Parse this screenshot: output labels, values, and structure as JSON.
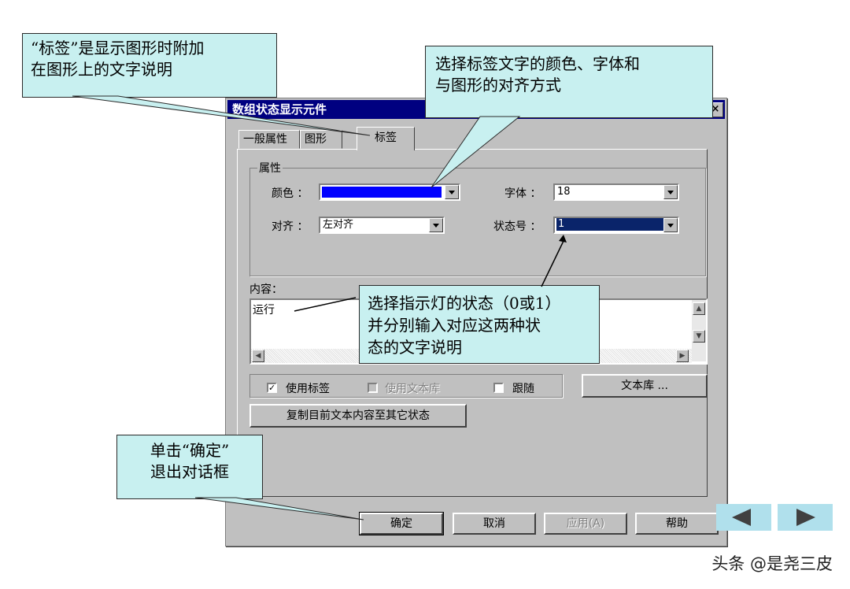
{
  "dialog": {
    "title": "数组状态显示元件",
    "close": "×",
    "tabs": [
      "一般属性",
      "图形",
      "标签"
    ],
    "group_label": "属性",
    "color_label": "颜色 ：",
    "color_value": "#0000ff",
    "align_label": "对齐 ：",
    "align_value": "左对齐",
    "font_label": "字体 ：",
    "font_value": "18",
    "state_label": "状态号 ：",
    "state_value": "1",
    "content_label": "内容：",
    "content_value": "运行",
    "use_label": "使用标签",
    "use_label_checked": true,
    "use_text_lib": "使用文本库",
    "follow": "跟随",
    "text_lib_button": "文本库 ...",
    "copy_button": "复制目前文本内容至其它状态",
    "ok": "确定",
    "cancel": "取消",
    "apply": "应用(A)",
    "help": "帮助"
  },
  "callouts": {
    "label_desc": [
      "“标签”是显示图形时附加",
      "在图形上的文字说明"
    ],
    "color_font": [
      "选择标签文字的颜色、字体和",
      "与图形的对齐方式"
    ],
    "state_desc": [
      "选择指示灯的状态（0或1）",
      "并分别输入对应这两种状",
      "态的文字说明"
    ],
    "ok_desc": [
      "单击“确定”",
      "退出对话框"
    ]
  },
  "watermark": "头条 @是尧三皮",
  "colors": {
    "callout_bg": "#c8f0f0",
    "dialog_bg": "#c0c0c0",
    "nav_arrow": "#b0e0ec"
  }
}
